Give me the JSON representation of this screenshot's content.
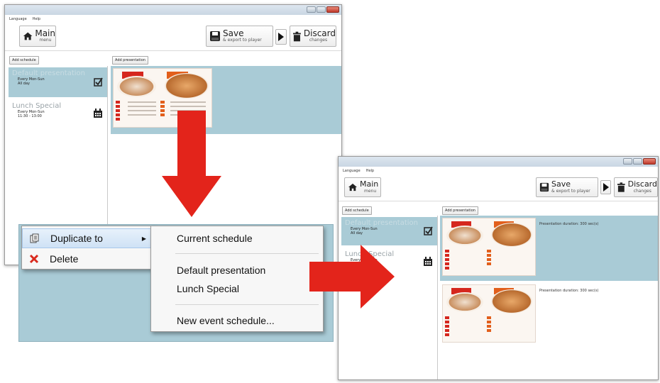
{
  "app": {
    "menu": [
      "Language",
      "Help"
    ],
    "main_label": "Main",
    "main_sub": "menu",
    "save_label": "Save",
    "save_sub": "& export to player",
    "discard_label": "Discard",
    "discard_sub": "changes",
    "add_schedule": "Add schedule",
    "add_presentation": "Add presentation"
  },
  "schedules": [
    {
      "name": "Default presentation",
      "days": "Every Mon-Sun",
      "time": "All day",
      "icon": "checkbox-icon"
    },
    {
      "name": "Lunch Special",
      "days": "Every Mon-Sun",
      "time": "11:30 - 13:00",
      "icon": "calendar-icon"
    }
  ],
  "presentations": [
    {
      "duration": "Presentation duration: 300 sec(s)"
    },
    {
      "duration": "Presentation duration: 300 sec(s)"
    }
  ],
  "context_menu": {
    "items": [
      {
        "label": "Duplicate to",
        "icon": "copy-icon"
      },
      {
        "label": "Delete",
        "icon": "delete-icon"
      }
    ],
    "submenu": [
      "Current schedule",
      "Default presentation",
      "Lunch Special",
      "New event schedule..."
    ]
  },
  "colors": {
    "selection": "#a9cbd6",
    "arrow": "#e3241b",
    "delete": "#d92a1e"
  }
}
